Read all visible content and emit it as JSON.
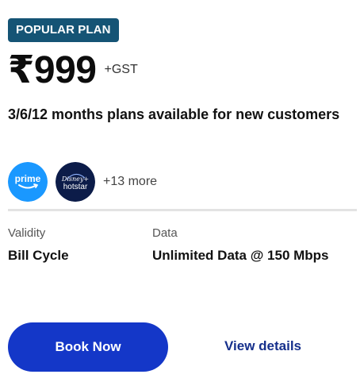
{
  "plan": {
    "badge": "POPULAR PLAN",
    "price": "₹999",
    "tax_note": "+GST",
    "description": "3/6/12 months plans available for new customers"
  },
  "ott": {
    "logos": [
      {
        "name": "prime",
        "label": "prime",
        "color": "#1a98ff"
      },
      {
        "name": "hotstar",
        "label_top": "Disney+",
        "label_bottom": "hotstar",
        "color": "#0c1c49"
      }
    ],
    "more_text": "+13 more"
  },
  "specs": {
    "validity_label": "Validity",
    "validity_value": "Bill Cycle",
    "data_label": "Data",
    "data_value": "Unlimited Data @ 150 Mbps"
  },
  "actions": {
    "book_label": "Book Now",
    "details_label": "View details"
  },
  "colors": {
    "badge_bg": "#155475",
    "primary_button": "#1437c8",
    "link": "#16308c",
    "divider": "#e3e3e3"
  }
}
